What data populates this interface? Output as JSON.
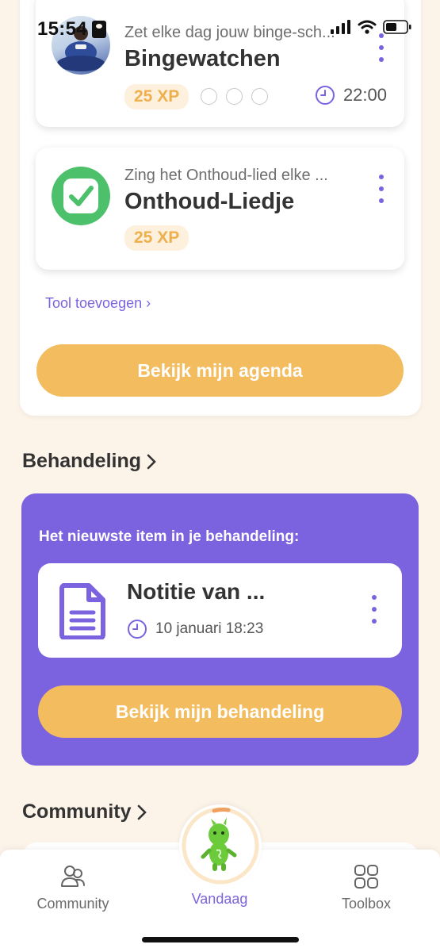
{
  "status_bar": {
    "time": "15:54"
  },
  "agenda": {
    "tasks": [
      {
        "subtitle": "Zet elke dag jouw binge-sch...",
        "title": "Bingewatchen",
        "xp": "25 XP",
        "time": "22:00",
        "thumbnail_icon": "person-watching-tv-photo"
      },
      {
        "subtitle": "Zing het Onthoud-lied elke ...",
        "title": "Onthoud-Liedje",
        "xp": "25 XP",
        "thumbnail_icon": "checkmark-icon"
      }
    ],
    "add_tool_label": "Tool toevoegen",
    "view_agenda_button": "Bekijk mijn agenda"
  },
  "treatment": {
    "heading": "Behandeling",
    "intro": "Het nieuwste item in je behandeling:",
    "latest_item": {
      "title": "Notitie van ...",
      "date": "10 januari 18:23",
      "icon": "document-icon"
    },
    "view_button": "Bekijk mijn behandeling"
  },
  "community": {
    "heading": "Community"
  },
  "bottom_nav": {
    "items": [
      {
        "label": "Community",
        "icon": "people-icon"
      },
      {
        "label": "Vandaag",
        "icon": "mascot-icon",
        "active": true
      },
      {
        "label": "Toolbox",
        "icon": "grid-icon"
      }
    ]
  },
  "colors": {
    "accent_purple": "#7B62DF",
    "accent_orange": "#F2BC5F",
    "background": "#FCF3E9",
    "check_green": "#4CC06B"
  }
}
